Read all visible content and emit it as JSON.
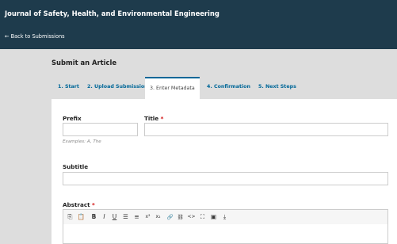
{
  "header": {
    "journal_title": "Journal of Safety, Health, and Environmental Engineering",
    "back_link": "← Back to Submissions"
  },
  "page": {
    "heading": "Submit an Article"
  },
  "tabs": [
    {
      "label": "1. Start",
      "active": false
    },
    {
      "label": "2. Upload Submission",
      "active": false
    },
    {
      "label": "3. Enter Metadata",
      "active": true
    },
    {
      "label": "4. Confirmation",
      "active": false
    },
    {
      "label": "5. Next Steps",
      "active": false
    }
  ],
  "form": {
    "prefix": {
      "label": "Prefix",
      "value": "",
      "hint": "Examples: A, The"
    },
    "title": {
      "label": "Title",
      "required_mark": "*",
      "value": ""
    },
    "subtitle": {
      "label": "Subtitle",
      "value": ""
    },
    "abstract": {
      "label": "Abstract",
      "required_mark": "*",
      "value": ""
    }
  },
  "toolbar": {
    "buttons": [
      {
        "name": "copy-icon",
        "glyph": "⎘"
      },
      {
        "name": "paste-icon",
        "glyph": "📋"
      },
      {
        "name": "bold-icon",
        "glyph": "B"
      },
      {
        "name": "italic-icon",
        "glyph": "I"
      },
      {
        "name": "underline-icon",
        "glyph": "U"
      },
      {
        "name": "bullet-list-icon",
        "glyph": "☰"
      },
      {
        "name": "numbered-list-icon",
        "glyph": "≡"
      },
      {
        "name": "superscript-icon",
        "glyph": "x²"
      },
      {
        "name": "subscript-icon",
        "glyph": "x₂"
      },
      {
        "name": "link-icon",
        "glyph": "🔗"
      },
      {
        "name": "unlink-icon",
        "glyph": "⛓"
      },
      {
        "name": "code-icon",
        "glyph": "<>"
      },
      {
        "name": "fullscreen-icon",
        "glyph": "⛶"
      },
      {
        "name": "image-icon",
        "glyph": "▣"
      },
      {
        "name": "upload-icon",
        "glyph": "⤓"
      }
    ]
  },
  "colors": {
    "header_bg": "#1e3b4c",
    "page_bg": "#dddddd",
    "accent": "#006798",
    "required": "#d00a0a"
  }
}
